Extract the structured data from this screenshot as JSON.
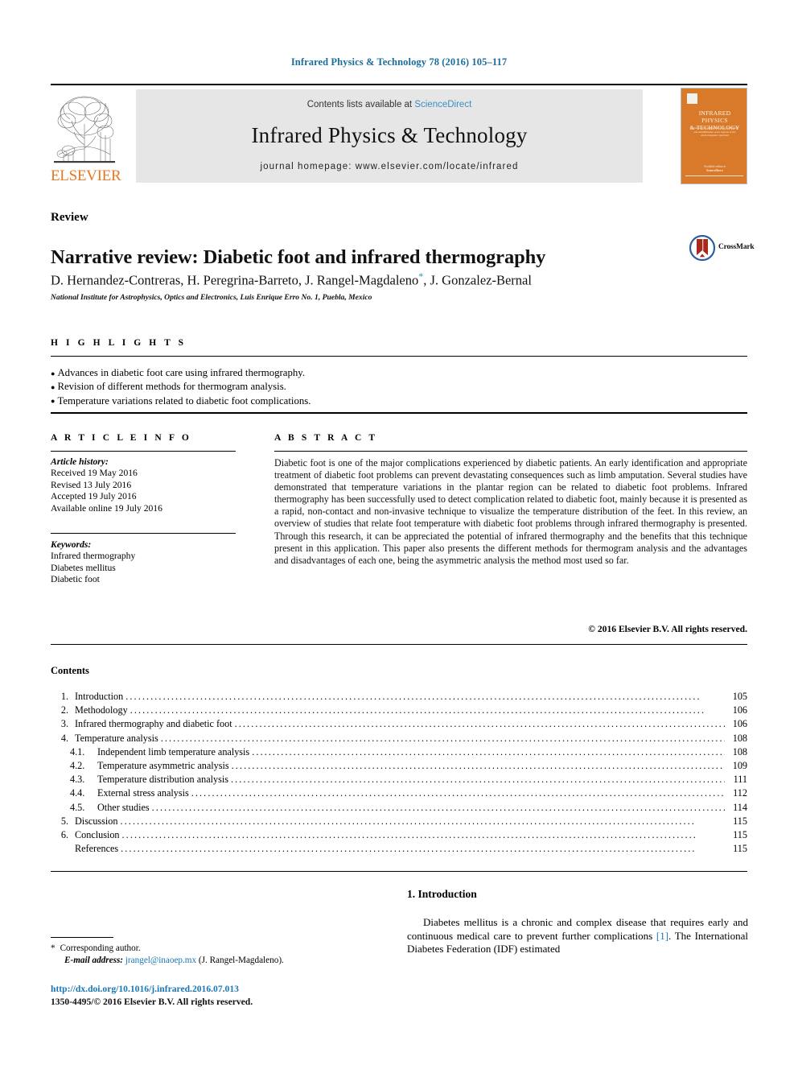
{
  "running_head": "Infrared Physics & Technology 78 (2016) 105–117",
  "masthead": {
    "contents_prefix": "Contents lists available at ",
    "sciencedirect": "ScienceDirect",
    "journal_title": "Infrared Physics & Technology",
    "journal_homepage": "journal homepage: www.elsevier.com/locate/infrared",
    "publisher_name": "ELSEVIER",
    "tree_logo_icon": "elsevier-tree-icon",
    "band_color": "#e6e6e6",
    "elsevier_orange": "#e87722",
    "link_blue": "#3a8fc4"
  },
  "cover": {
    "title_line1": "INFRARED PHYSICS",
    "title_line2": "& TECHNOLOGY",
    "subtitle": "A journal covering the infrared, far-infrared and submillimetre wave regions of the electromagnetic spectrum",
    "bottom_note": "Available online at",
    "bottom_brand": "ScienceDirect",
    "background_color": "#d9792a"
  },
  "article": {
    "doctype": "Review",
    "title": "Narrative review: Diabetic foot and infrared thermography",
    "authors": "D. Hernandez-Contreras, H. Peregrina-Barreto, J. Rangel-Magdaleno",
    "authors_tail": ", J. Gonzalez-Bernal",
    "corresponding_marker": "*",
    "affiliation": "National Institute for Astrophysics, Optics and Electronics, Luis Enrique Erro No. 1, Puebla, Mexico"
  },
  "crossmark": {
    "label": "CrossMark",
    "icon": "crossmark-icon",
    "ring_color": "#2c5f9e",
    "shield_color": "#a82a1a"
  },
  "highlights": {
    "heading": "H I G H L I G H T S",
    "items": [
      "Advances in diabetic foot care using infrared thermography.",
      "Revision of different methods for thermogram analysis.",
      "Temperature variations related to diabetic foot complications."
    ]
  },
  "article_info": {
    "heading": "A R T I C L E    I N F O",
    "history_label": "Article history:",
    "history": [
      "Received 19 May 2016",
      "Revised 13 July 2016",
      "Accepted 19 July 2016",
      "Available online 19 July 2016"
    ],
    "keywords_label": "Keywords:",
    "keywords": [
      "Infrared thermography",
      "Diabetes mellitus",
      "Diabetic foot"
    ]
  },
  "abstract": {
    "heading": "A B S T R A C T",
    "text": "Diabetic foot is one of the major complications experienced by diabetic patients. An early identification and appropriate treatment of diabetic foot problems can prevent devastating consequences such as limb amputation. Several studies have demonstrated that temperature variations in the plantar region can be related to diabetic foot problems. Infrared thermography has been successfully used to detect complication related to diabetic foot, mainly because it is presented as a rapid, non-contact and non-invasive technique to visualize the temperature distribution of the feet. In this review, an overview of studies that relate foot temperature with diabetic foot problems through infrared thermography is presented. Through this research, it can be appreciated the potential of infrared thermography and the benefits that this technique present in this application. This paper also presents the different methods for thermogram analysis and the advantages and disadvantages of each one, being the asymmetric analysis the method most used so far.",
    "copyright": "© 2016 Elsevier B.V. All rights reserved."
  },
  "contents": {
    "heading": "Contents",
    "rows": [
      {
        "num": "1.",
        "title": "Introduction",
        "page": "105",
        "sub": false
      },
      {
        "num": "2.",
        "title": "Methodology",
        "page": "106",
        "sub": false
      },
      {
        "num": "3.",
        "title": "Infrared thermography and diabetic foot",
        "page": "106",
        "sub": false
      },
      {
        "num": "4.",
        "title": "Temperature analysis",
        "page": "108",
        "sub": false
      },
      {
        "num": "4.1.",
        "title": "Independent limb temperature analysis",
        "page": "108",
        "sub": true
      },
      {
        "num": "4.2.",
        "title": "Temperature asymmetric analysis",
        "page": "109",
        "sub": true
      },
      {
        "num": "4.3.",
        "title": "Temperature distribution analysis",
        "page": "111",
        "sub": true
      },
      {
        "num": "4.4.",
        "title": "External stress analysis",
        "page": "112",
        "sub": true
      },
      {
        "num": "4.5.",
        "title": "Other studies",
        "page": "114",
        "sub": true
      },
      {
        "num": "5.",
        "title": "Discussion",
        "page": "115",
        "sub": false
      },
      {
        "num": "6.",
        "title": "Conclusion",
        "page": "115",
        "sub": false
      },
      {
        "num": "",
        "title": "References",
        "page": "115",
        "sub": false
      }
    ]
  },
  "introduction": {
    "heading": "1. Introduction",
    "text_a": "Diabetes mellitus is a chronic and complex disease that requires early and continuous medical care to prevent further complications ",
    "ref": "[1]",
    "text_b": ". The International Diabetes Federation (IDF) estimated"
  },
  "footnote": {
    "star": "*",
    "corresponding": "Corresponding author.",
    "email_label": "E-mail address:",
    "email": "jrangel@inaoep.mx",
    "email_owner": "(J. Rangel-Magdaleno).",
    "doi": "http://dx.doi.org/10.1016/j.infrared.2016.07.013",
    "issn_line": "1350-4495/© 2016 Elsevier B.V. All rights reserved."
  }
}
